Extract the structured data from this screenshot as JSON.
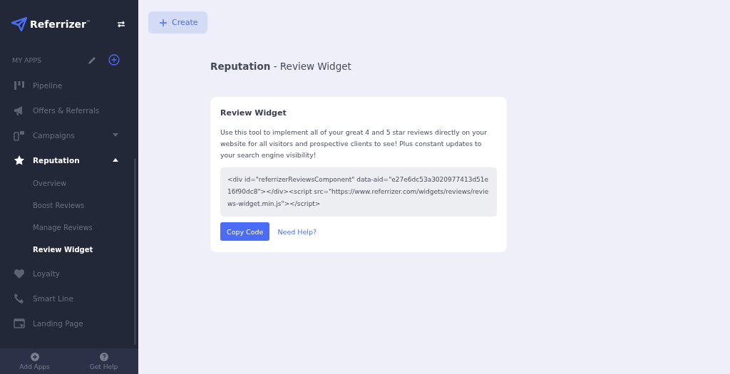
{
  "sidebar": {
    "brand": "Referrizer",
    "brand_mark": "™",
    "section_label": "MY APPS",
    "items": [
      {
        "label": "Pipeline",
        "kind": "pipeline",
        "selected": false
      },
      {
        "label": "Offers & Referrals",
        "kind": "megaphone",
        "selected": false
      },
      {
        "label": "Campaigns",
        "kind": "devices",
        "selected": false,
        "expanded": false
      },
      {
        "label": "Reputation",
        "kind": "star",
        "selected": true,
        "expanded": true,
        "children": [
          {
            "label": "Overview",
            "selected": false
          },
          {
            "label": "Boost Reviews",
            "selected": false
          },
          {
            "label": "Manage Reviews",
            "selected": false
          },
          {
            "label": "Review Widget",
            "selected": true
          }
        ]
      },
      {
        "label": "Loyalty",
        "kind": "heart",
        "selected": false
      },
      {
        "label": "Smart Line",
        "kind": "phone",
        "selected": false
      },
      {
        "label": "Landing Page",
        "kind": "page",
        "selected": false
      }
    ],
    "footer": [
      {
        "label": "Add Apps",
        "kind": "add"
      },
      {
        "label": "Get Help",
        "kind": "help"
      }
    ]
  },
  "toolbar": {
    "create_button": "Create"
  },
  "page_title": "**Reputation** - Review Widget",
  "card": {
    "title": "Review Widget",
    "description": "Use this tool to implement all of your great 4 and 5 star reviews directly on your website for all visitors and prospective clients to see! Plus constant updates to your search engine visibility!",
    "code": "<div id=\"referrizerReviewsComponent\" data-aid=\"e27e6dc53a3020977413d51e16f90dc8\"></div><script src=\"https://www.referrizer.com/widgets/reviews/reviews-widget.min.js\"></script>",
    "copy_button": "Copy Code",
    "help_link": "Need Help?"
  }
}
